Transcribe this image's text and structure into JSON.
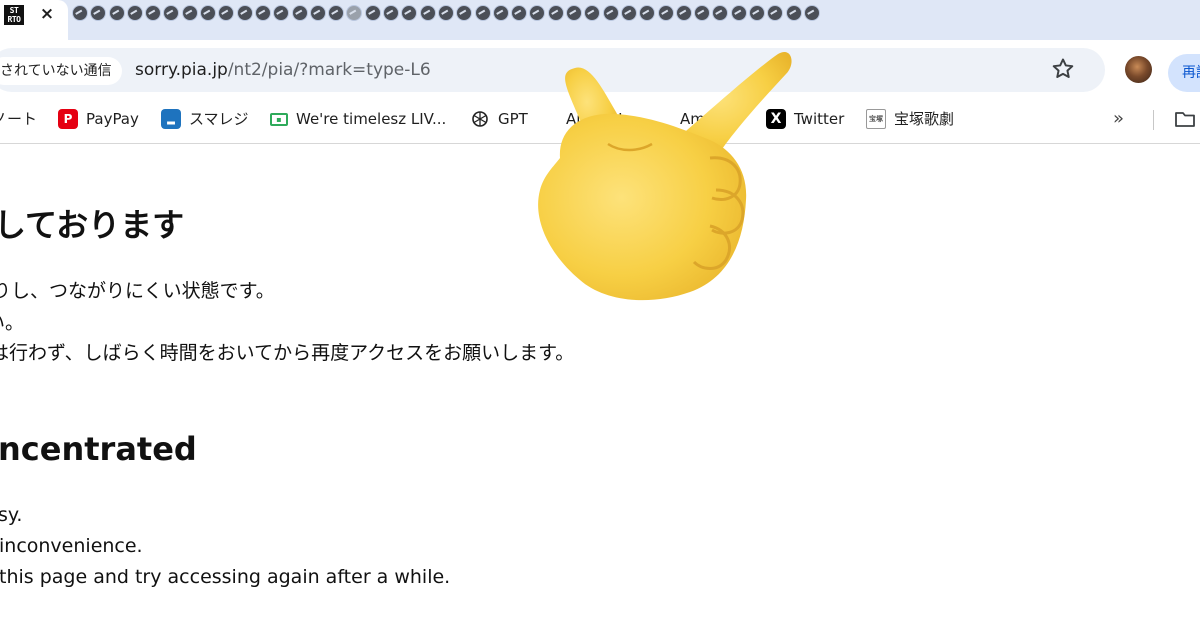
{
  "tabs": {
    "active": {
      "favicon_text": "STA RTO",
      "close_glyph": "×",
      "icon": "close-icon"
    },
    "mini_tab_count": 41,
    "mini_tab_icon": "pia-favicon-icon"
  },
  "toolbar": {
    "security_chip": "されていない通信",
    "url_host": "sorry.pia.jp",
    "url_path": "/nt2/pia/?mark=type-L6",
    "bookmark_star_icon": "star-icon",
    "reload_chip": "再読"
  },
  "bookmarks": [
    {
      "label": "ノート",
      "icon": "note-icon"
    },
    {
      "label": "PayPay",
      "icon": "paypay-icon",
      "color": "#e50012"
    },
    {
      "label": "スマレジ",
      "icon": "smaregi-icon",
      "color": "#1e73be"
    },
    {
      "label": "We're timelesz LIV...",
      "icon": "ticket-icon",
      "color": "#2eaa5a"
    },
    {
      "label": "GPT",
      "icon": "openai-icon"
    },
    {
      "label": "AirREGI",
      "icon": "airregi-icon"
    },
    {
      "label": "Amazon",
      "icon": "amazon-icon"
    },
    {
      "label": "Twitter",
      "icon": "x-icon"
    },
    {
      "label": "宝塚歌劇",
      "icon": "takarazuka-icon"
    }
  ],
  "overflow_glyph": "»",
  "page": {
    "ja_heading": "しております",
    "ja_lines": [
      "りし、つながりにくい状態です。",
      "い。",
      "は行わず、しばらく時間をおいてから再度アクセスをお願いします。"
    ],
    "en_heading": "ncentrated",
    "en_lines": [
      "sy.",
      "inconvenience.",
      "this page and try accessing again after a while."
    ]
  },
  "overlay": {
    "emoji": "backhand-index-pointing-right",
    "skin_color": "#f7cf44"
  }
}
